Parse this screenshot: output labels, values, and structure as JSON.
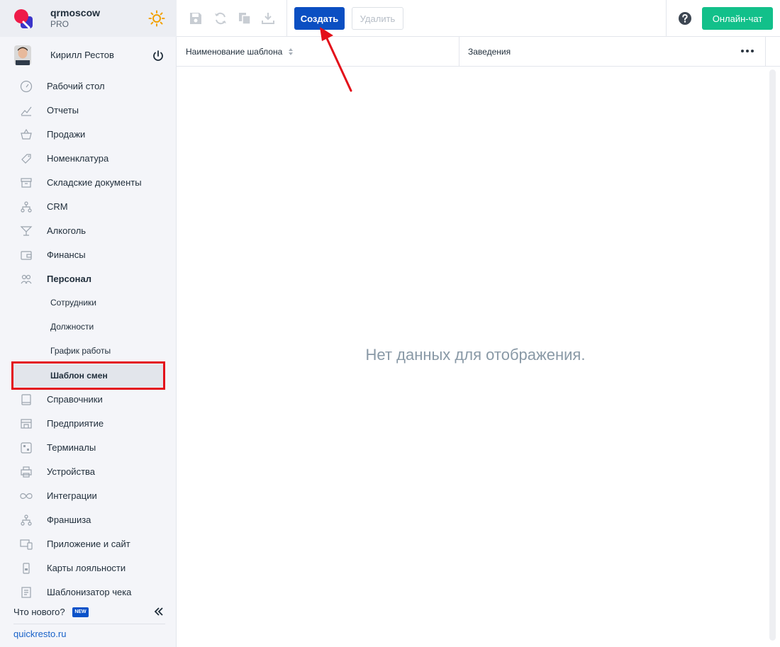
{
  "brand": {
    "name": "qrmoscow",
    "plan": "PRO"
  },
  "user": {
    "name": "Кирилл Рестов"
  },
  "nav": {
    "items": [
      {
        "label": "Рабочий стол",
        "icon": "dashboard-icon"
      },
      {
        "label": "Отчеты",
        "icon": "reports-icon"
      },
      {
        "label": "Продажи",
        "icon": "basket-icon"
      },
      {
        "label": "Номенклатура",
        "icon": "tag-icon"
      },
      {
        "label": "Складские документы",
        "icon": "archive-icon"
      },
      {
        "label": "CRM",
        "icon": "hierarchy-icon"
      },
      {
        "label": "Алкоголь",
        "icon": "cocktail-icon"
      },
      {
        "label": "Финансы",
        "icon": "wallet-icon"
      },
      {
        "label": "Персонал",
        "icon": "people-icon"
      }
    ],
    "personnel_sub": [
      {
        "label": "Сотрудники"
      },
      {
        "label": "Должности"
      },
      {
        "label": "График работы"
      },
      {
        "label": "Шаблон смен"
      }
    ],
    "items_after": [
      {
        "label": "Справочники",
        "icon": "book-icon"
      },
      {
        "label": "Предприятие",
        "icon": "store-icon"
      },
      {
        "label": "Терминалы",
        "icon": "qr-icon"
      },
      {
        "label": "Устройства",
        "icon": "printer-icon"
      },
      {
        "label": "Интеграции",
        "icon": "infinity-icon"
      },
      {
        "label": "Франшиза",
        "icon": "hierarchy-icon"
      },
      {
        "label": "Приложение и сайт",
        "icon": "devices-icon"
      },
      {
        "label": "Карты лояльности",
        "icon": "card-icon"
      },
      {
        "label": "Шаблонизатор чека",
        "icon": "receipt-icon"
      }
    ]
  },
  "footer": {
    "whats_new": "Что нового?",
    "badge": "NEW",
    "site": "quickresto.ru"
  },
  "toolbar": {
    "create": "Создать",
    "delete": "Удалить",
    "chat": "Онлайн-чат"
  },
  "grid": {
    "columns": [
      "Наименование шаблона",
      "Заведения"
    ],
    "empty": "Нет данных для отображения."
  },
  "colors": {
    "accent": "#0b4fc2",
    "chat": "#12c08a",
    "highlight": "#e3101a"
  }
}
